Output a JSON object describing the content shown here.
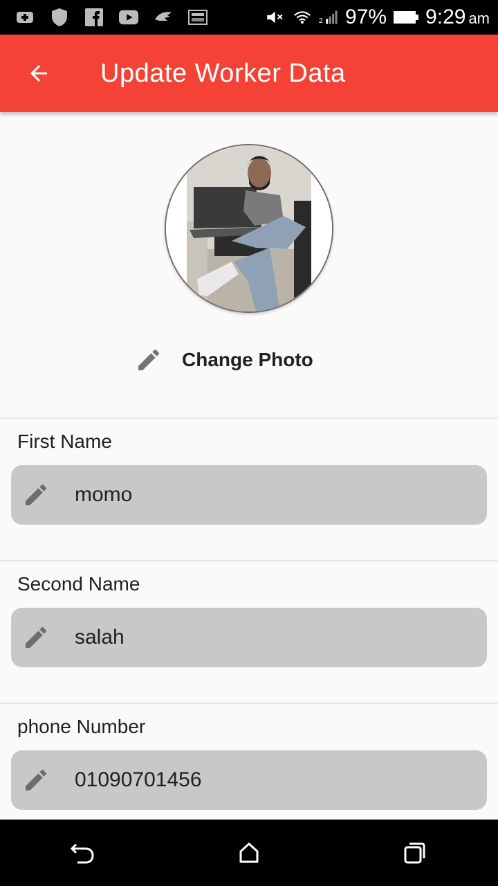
{
  "status_bar": {
    "battery": "97%",
    "time": "9:29",
    "ampm": "am",
    "icons": [
      "add-box-icon",
      "shield-icon",
      "facebook-icon",
      "youtube-icon",
      "app-icon",
      "image-icon",
      "mute-icon",
      "wifi-icon",
      "signal-icon",
      "battery-icon"
    ]
  },
  "app_bar": {
    "title": "Update Worker Data",
    "back_icon": "arrow-back-icon",
    "color": "#f44336"
  },
  "profile": {
    "change_photo_label": "Change Photo",
    "edit_icon": "pencil-icon"
  },
  "fields": [
    {
      "label": "First Name",
      "value": "momo"
    },
    {
      "label": "Second Name",
      "value": "salah"
    },
    {
      "label": "phone Number",
      "value": "01090701456"
    }
  ],
  "nav": {
    "icons": [
      "back-nav-icon",
      "home-icon",
      "recents-icon"
    ]
  }
}
